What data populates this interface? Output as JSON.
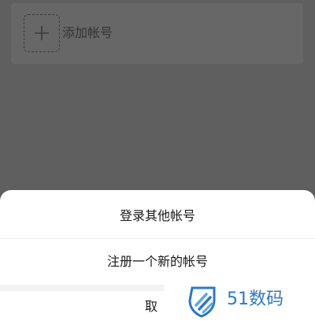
{
  "account_card": {
    "add_icon": "plus-icon",
    "add_label": "添加帐号"
  },
  "action_sheet": {
    "options": [
      {
        "label": "登录其他帐号"
      },
      {
        "label": "注册一个新的帐号"
      }
    ],
    "cancel_label": "取"
  },
  "watermark": {
    "icon": "shield-logo-icon",
    "text": "51数码"
  },
  "colors": {
    "overlay": "#5f5f5f",
    "card": "#676767",
    "sheet": "#ffffff",
    "watermark_blue": "#2d77c8"
  }
}
